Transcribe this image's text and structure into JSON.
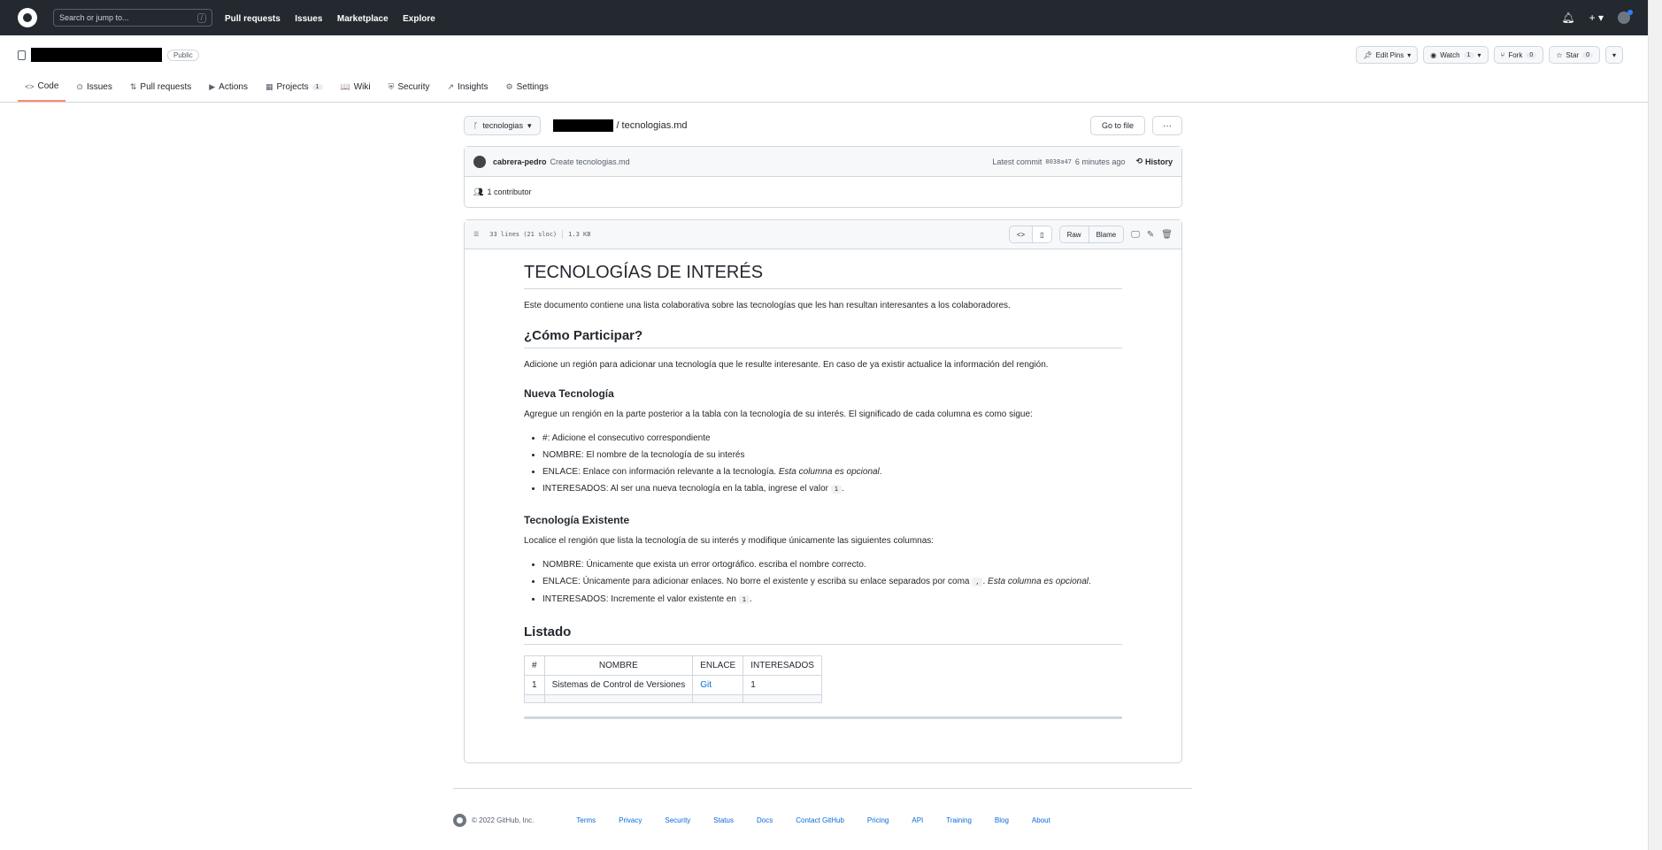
{
  "header": {
    "search_placeholder": "Search or jump to...",
    "search_shortcut": "/",
    "nav": [
      "Pull requests",
      "Issues",
      "Marketplace",
      "Explore"
    ],
    "icons": [
      "bell-icon",
      "plus-icon",
      "avatar"
    ]
  },
  "repo": {
    "visibility": "Public",
    "actions": {
      "edit_pins": "Edit Pins",
      "watch": "Watch",
      "watch_count": "1",
      "fork": "Fork",
      "fork_count": "0",
      "star": "Star",
      "star_count": "0"
    },
    "tabs": [
      {
        "label": "Code",
        "icon": "<>"
      },
      {
        "label": "Issues",
        "icon": "⊙"
      },
      {
        "label": "Pull requests",
        "icon": "⇅"
      },
      {
        "label": "Actions",
        "icon": "▶"
      },
      {
        "label": "Projects",
        "icon": "▦",
        "count": "1"
      },
      {
        "label": "Wiki",
        "icon": "📖"
      },
      {
        "label": "Security",
        "icon": "⛨"
      },
      {
        "label": "Insights",
        "icon": "↗"
      },
      {
        "label": "Settings",
        "icon": "⚙"
      }
    ]
  },
  "file_nav": {
    "branch": "tecnologias",
    "breadcrumb_sep": "/",
    "filename": "tecnologias.md",
    "goto_file": "Go to file",
    "more": "···"
  },
  "commit": {
    "author": "cabrera-pedro",
    "message": "Create tecnologias.md",
    "latest_label": "Latest commit",
    "sha": "8038a47",
    "time": "6 minutes ago",
    "history": "History",
    "contributors": "1 contributor"
  },
  "file_header": {
    "lines": "33 lines (21 sloc)",
    "size": "1.3 KB",
    "raw": "Raw",
    "blame": "Blame"
  },
  "markdown": {
    "h1": "TECNOLOGÍAS DE INTERÉS",
    "intro": "Este documento contiene una lista colaborativa sobre las tecnologías que les han resultan interesantes a los colaboradores.",
    "h2_participar": "¿Cómo Participar?",
    "participar_text": "Adicione un región para adicionar una tecnología que le resulte interesante. En caso de ya existir actualice la información del rengión.",
    "h3_nueva": "Nueva Tecnología",
    "nueva_text": "Agregue un rengión en la parte posterior a la tabla con la tecnología de su interés. El significado de cada columna es como sigue:",
    "nueva_items": [
      {
        "key": "#",
        "text": ": Adicione el consecutivo correspondiente"
      },
      {
        "key": "NOMBRE",
        "text": ": El nombre de la tecnología de su interés"
      },
      {
        "key": "ENLACE",
        "text": ": Enlace con información relevante a la tecnología. ",
        "em": "Esta columna es opcional",
        "tail": "."
      },
      {
        "key": "INTERESADOS",
        "text": ": Al ser una nueva tecnología en la tabla, ingrese el valor ",
        "code": "1",
        "tail": "."
      }
    ],
    "h3_existente": "Tecnología Existente",
    "existente_text": "Localice el rengión que lista la tecnología de su interés y modifique únicamente las siguientes columnas:",
    "existente_items": [
      {
        "key": "NOMBRE",
        "text": ": Únicamente que exista un error ortográfico. escriba el nombre correcto."
      },
      {
        "key": "ENLACE",
        "text": ": Únicamente para adicionar enlaces. No borre el existente y escriba su enlace separados por coma ",
        "code": ",",
        "em": "Esta columna es opcional",
        "tail": "."
      },
      {
        "key": "INTERESADOS",
        "text": ": Incremente el valor existente en ",
        "code": "1",
        "tail": "."
      }
    ],
    "h2_listado": "Listado",
    "table": {
      "headers": [
        "#",
        "NOMBRE",
        "ENLACE",
        "INTERESADOS"
      ],
      "rows": [
        [
          "1",
          "Sistemas de Control de Versiones",
          "Git",
          "1"
        ]
      ]
    }
  },
  "footer": {
    "copyright": "© 2022 GitHub, Inc.",
    "links": [
      "Terms",
      "Privacy",
      "Security",
      "Status",
      "Docs",
      "Contact GitHub",
      "Pricing",
      "API",
      "Training",
      "Blog",
      "About"
    ]
  }
}
